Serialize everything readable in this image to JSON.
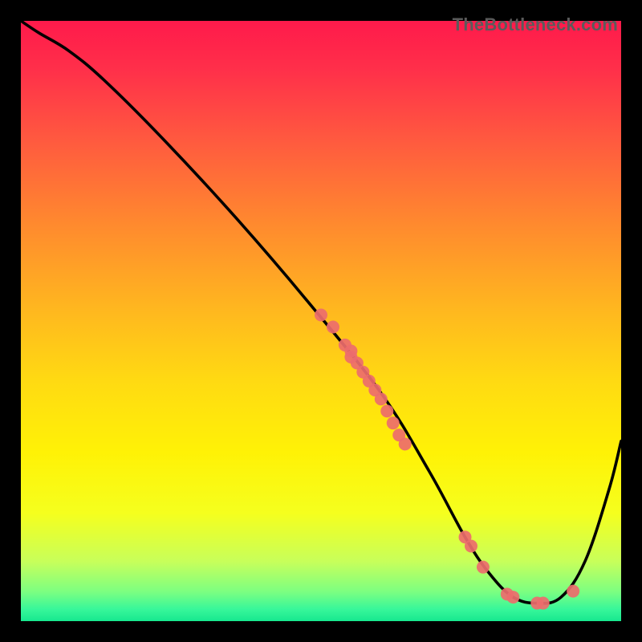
{
  "watermark": "TheBottleneck.com",
  "chart_data": {
    "type": "line",
    "xlim": [
      0,
      100
    ],
    "ylim": [
      0,
      100
    ],
    "title": "",
    "xlabel": "",
    "ylabel": "",
    "series": [
      {
        "name": "curve",
        "x": [
          0,
          3,
          8,
          14,
          24,
          36,
          48,
          60,
          68,
          74,
          78,
          82,
          86,
          90,
          94,
          98,
          100
        ],
        "y": [
          100,
          98,
          95,
          90,
          80,
          67,
          53,
          38,
          25,
          14,
          8,
          4,
          3,
          4,
          10,
          22,
          30
        ]
      }
    ],
    "points": {
      "name": "dots",
      "x": [
        50,
        52,
        54,
        55,
        55,
        56,
        57,
        58,
        59,
        60,
        61,
        62,
        63,
        64,
        74,
        75,
        77,
        81,
        82,
        86,
        87,
        92
      ],
      "y": [
        51,
        49,
        46,
        45,
        44,
        43,
        41.5,
        40,
        38.5,
        37,
        35,
        33,
        31,
        29.5,
        14,
        12.5,
        9,
        4.5,
        4,
        3,
        3,
        5
      ]
    },
    "gradient_stops": [
      {
        "offset": 0.0,
        "color": "#ff1a4b"
      },
      {
        "offset": 0.08,
        "color": "#ff2f4a"
      },
      {
        "offset": 0.2,
        "color": "#ff5a3f"
      },
      {
        "offset": 0.34,
        "color": "#ff8a2e"
      },
      {
        "offset": 0.48,
        "color": "#ffb71f"
      },
      {
        "offset": 0.6,
        "color": "#ffda12"
      },
      {
        "offset": 0.72,
        "color": "#fff206"
      },
      {
        "offset": 0.82,
        "color": "#f5ff1e"
      },
      {
        "offset": 0.9,
        "color": "#c8ff5a"
      },
      {
        "offset": 0.95,
        "color": "#7eff80"
      },
      {
        "offset": 0.98,
        "color": "#38f79a"
      },
      {
        "offset": 1.0,
        "color": "#17e88f"
      }
    ],
    "curve_color": "#000000",
    "point_color": "#ed6d6d",
    "point_radius": 8
  }
}
